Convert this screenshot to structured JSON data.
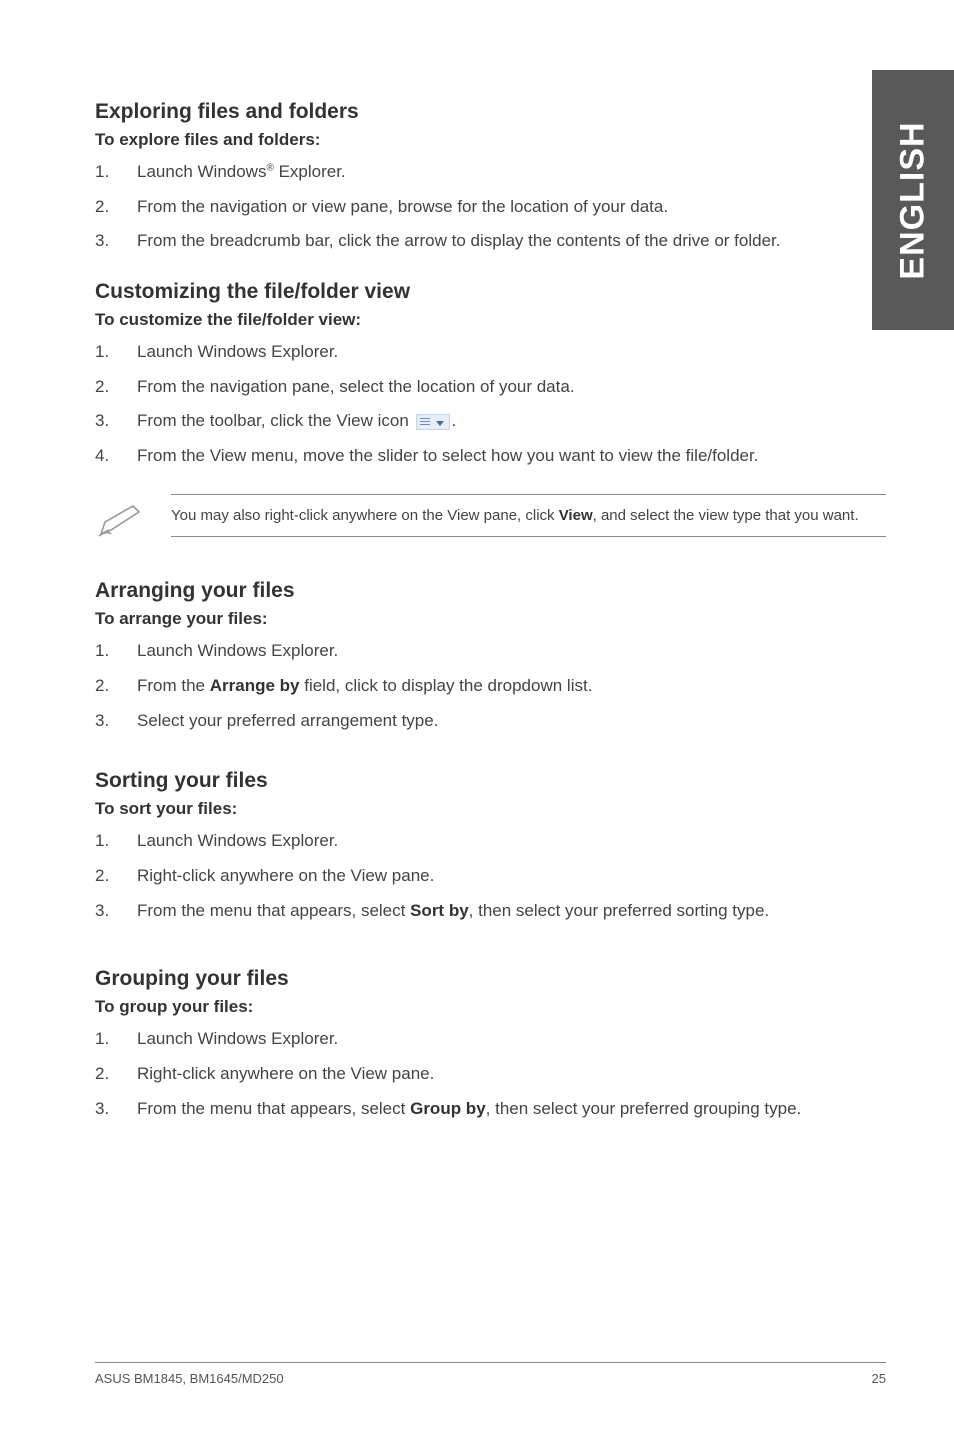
{
  "side_tab": "ENGLISH",
  "sections": {
    "explore": {
      "heading": "Exploring files and folders",
      "sub": "To explore files and folders:",
      "items": [
        {
          "n": "1.",
          "pre": "Launch Windows",
          "sup": "®",
          "post": " Explorer."
        },
        {
          "n": "2.",
          "text": "From the navigation or view pane, browse for the location of your data."
        },
        {
          "n": "3.",
          "text": "From the breadcrumb bar, click the arrow to display the contents of the drive or folder."
        }
      ]
    },
    "customize": {
      "heading": "Customizing the file/folder view",
      "sub": "To customize the file/folder view:",
      "items": [
        {
          "n": "1.",
          "text": "Launch Windows Explorer."
        },
        {
          "n": "2.",
          "text": "From the navigation pane, select the location of your data."
        },
        {
          "n": "3.",
          "pre": "From the toolbar, click the View icon ",
          "icon": true,
          "post": "."
        },
        {
          "n": "4.",
          "text": "From the View menu, move the slider to select how you want to view the file/folder."
        }
      ]
    },
    "note": {
      "pre": "You may also right-click anywhere on the View pane, click ",
      "bold": "View",
      "post": ", and select the view type that you want."
    },
    "arrange": {
      "heading": "Arranging your files",
      "sub": "To arrange your files:",
      "items": [
        {
          "n": "1.",
          "text": "Launch Windows Explorer."
        },
        {
          "n": "2.",
          "pre": "From the ",
          "bold": "Arrange by",
          "post": " field, click to display the dropdown list."
        },
        {
          "n": "3.",
          "text": "Select your preferred arrangement type."
        }
      ]
    },
    "sort": {
      "heading": "Sorting your files",
      "sub": "To sort your files:",
      "items": [
        {
          "n": "1.",
          "text": "Launch Windows Explorer."
        },
        {
          "n": "2.",
          "text": "Right-click anywhere on the View pane."
        },
        {
          "n": "3.",
          "pre": "From the menu that appears, select ",
          "bold": "Sort by",
          "post": ", then select your preferred sorting type."
        }
      ]
    },
    "group": {
      "heading": "Grouping your files",
      "sub": "To group your files:",
      "items": [
        {
          "n": "1.",
          "text": "Launch Windows Explorer."
        },
        {
          "n": "2.",
          "text": "Right-click anywhere on the View pane."
        },
        {
          "n": "3.",
          "pre": "From the menu that appears, select ",
          "bold": "Group by",
          "post": ", then select your preferred grouping type."
        }
      ]
    }
  },
  "footer": {
    "left": "ASUS BM1845, BM1645/MD250",
    "right": "25"
  }
}
